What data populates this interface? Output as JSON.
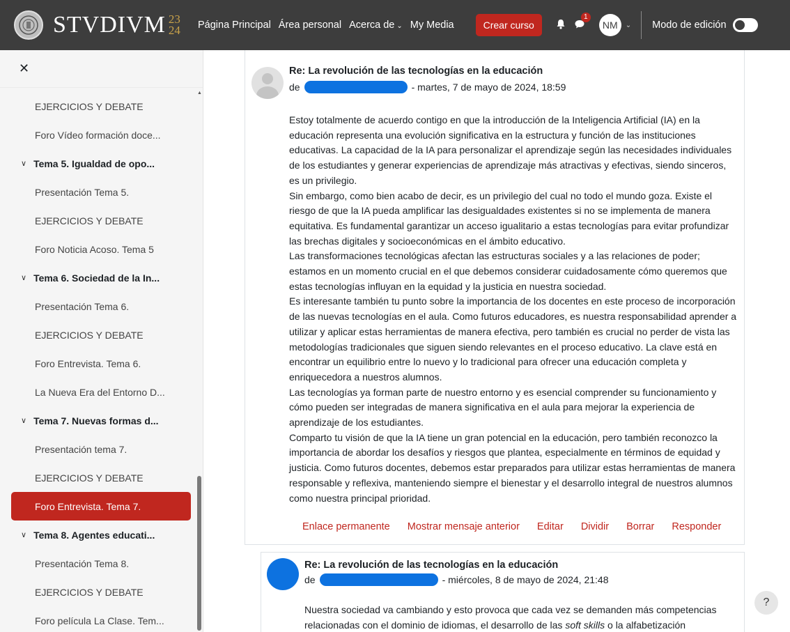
{
  "header": {
    "brand_name": "STVDIVM",
    "brand_year_top": "23",
    "brand_year_bottom": "24",
    "nav": [
      "Página Principal",
      "Área personal",
      "Acerca de",
      "My Media"
    ],
    "create_button": "Crear curso",
    "notifications_icon": "bell-icon",
    "messages_icon": "chat-icon",
    "messages_badge": "1",
    "user_initials": "NM",
    "edit_mode_label": "Modo de edición",
    "edit_mode_on": false
  },
  "sidebar": {
    "close_icon": "close-icon",
    "items": [
      {
        "type": "leaf",
        "label": "EJERCICIOS Y DEBATE"
      },
      {
        "type": "leaf",
        "label": "Foro Vídeo formación doce..."
      },
      {
        "type": "section",
        "label": "Tema 5. Igualdad de opo..."
      },
      {
        "type": "leaf",
        "label": "Presentación Tema 5."
      },
      {
        "type": "leaf",
        "label": "EJERCICIOS Y DEBATE"
      },
      {
        "type": "leaf",
        "label": "Foro Noticia Acoso. Tema 5"
      },
      {
        "type": "section",
        "label": "Tema 6. Sociedad de la In..."
      },
      {
        "type": "leaf",
        "label": "Presentación Tema 6."
      },
      {
        "type": "leaf",
        "label": "EJERCICIOS Y DEBATE"
      },
      {
        "type": "leaf",
        "label": "Foro Entrevista. Tema 6."
      },
      {
        "type": "leaf",
        "label": "La Nueva Era del Entorno D..."
      },
      {
        "type": "section",
        "label": "Tema 7. Nuevas formas d..."
      },
      {
        "type": "leaf",
        "label": "Presentación tema 7."
      },
      {
        "type": "leaf",
        "label": "EJERCICIOS Y DEBATE"
      },
      {
        "type": "active",
        "label": "Foro Entrevista. Tema 7."
      },
      {
        "type": "section",
        "label": "Tema 8. Agentes educati..."
      },
      {
        "type": "leaf",
        "label": "Presentación Tema 8."
      },
      {
        "type": "leaf",
        "label": "EJERCICIOS Y DEBATE"
      },
      {
        "type": "leaf",
        "label": "Foro película La Clase. Tem..."
      }
    ]
  },
  "post1": {
    "title": "Re: La revolución de las tecnologías en la educación",
    "by_prefix": "de",
    "date": "- martes, 7 de mayo de 2024, 18:59",
    "paragraphs": [
      "Estoy totalmente de acuerdo contigo en que la introducción de la Inteligencia Artificial (IA) en la educación representa una evolución significativa en la estructura y función de las instituciones educativas. La capacidad de la IA para personalizar el aprendizaje según las necesidades individuales de los estudiantes y generar experiencias de aprendizaje más atractivas y efectivas, siendo sinceros, es un privilegio.",
      "Sin embargo, como bien acabo de decir, es un privilegio del cual no todo el mundo goza. Existe el riesgo de que la IA pueda amplificar las desigualdades existentes si no se implementa de manera equitativa. Es fundamental garantizar un acceso igualitario a estas tecnologías para evitar profundizar las brechas digitales y socioeconómicas en el ámbito educativo.",
      "Las transformaciones tecnológicas afectan las estructuras sociales y a las relaciones de poder; estamos en un momento crucial en el que debemos considerar cuidadosamente cómo queremos que estas tecnologías influyan en la equidad y la justicia en nuestra sociedad.",
      "Es interesante también tu punto sobre la importancia de los docentes en este proceso de incorporación de las nuevas tecnologías en el aula. Como futuros educadores, es nuestra responsabilidad aprender a utilizar y aplicar estas herramientas de manera efectiva, pero también es crucial no perder de vista las metodologías tradicionales que siguen siendo relevantes en el proceso educativo. La clave está en encontrar un equilibrio entre lo nuevo y lo tradicional para ofrecer una educación completa y enriquecedora a nuestros alumnos.",
      "Las tecnologías ya forman parte de nuestro entorno y es esencial comprender su funcionamiento y cómo pueden ser integradas de manera significativa en el aula para mejorar la experiencia de aprendizaje de los estudiantes.",
      "Comparto tu visión de que la IA tiene un gran potencial en la educación, pero también reconozco la importancia de abordar los desafíos y riesgos que plantea, especialmente en términos de equidad y justicia. Como futuros docentes, debemos estar preparados para utilizar estas herramientas de manera responsable y reflexiva, manteniendo siempre el bienestar y el desarrollo integral de nuestros alumnos como nuestra principal prioridad."
    ],
    "actions": [
      "Enlace permanente",
      "Mostrar mensaje anterior",
      "Editar",
      "Dividir",
      "Borrar",
      "Responder"
    ]
  },
  "post2": {
    "title": "Re: La revolución de las tecnologías en la educación",
    "by_prefix": "de",
    "date": "- miércoles, 8 de mayo de 2024, 21:48",
    "text_before": "Nuestra sociedad va cambiando y esto provoca que cada vez se demanden más competencias relacionadas con el dominio de idiomas, el desarrollo de las ",
    "text_em": "soft skills",
    "text_after": " o la alfabetización"
  },
  "help_label": "?",
  "colors": {
    "topbar": "#3d3d3d",
    "accent": "#c0271f",
    "redaction": "#0d72e0",
    "sidebar_bg": "#f5f5f5"
  }
}
